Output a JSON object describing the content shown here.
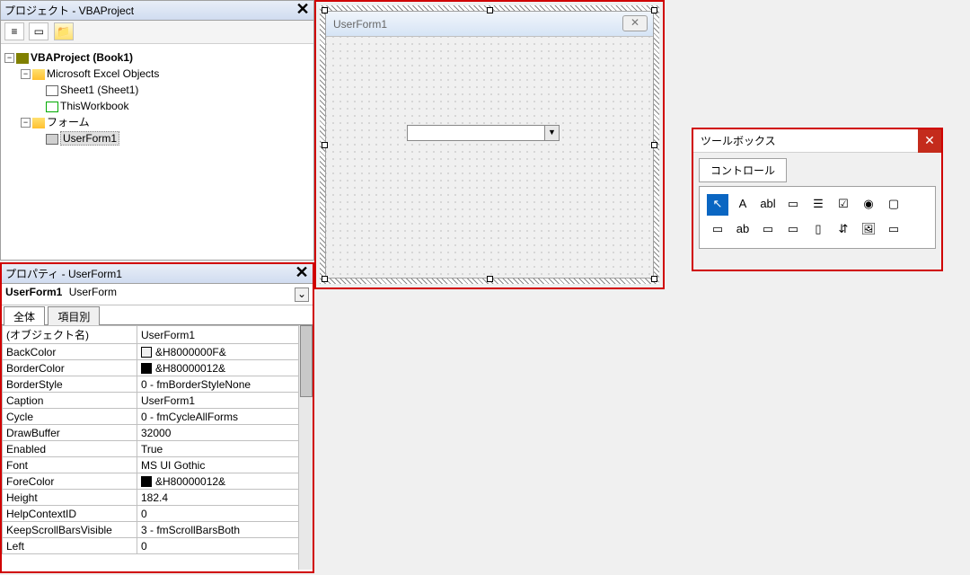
{
  "project": {
    "title": "プロジェクト - VBAProject",
    "root": "VBAProject (Book1)",
    "folder1": "Microsoft Excel Objects",
    "sheet1": "Sheet1 (Sheet1)",
    "thiswb": "ThisWorkbook",
    "folder2": "フォーム",
    "userform": "UserForm1"
  },
  "properties": {
    "title": "プロパティ - UserForm1",
    "obj_name": "UserForm1",
    "obj_type": "UserForm",
    "tab1": "全体",
    "tab2": "項目別",
    "rows": [
      {
        "k": "(オブジェクト名)",
        "v": "UserForm1"
      },
      {
        "k": "BackColor",
        "v": "&H8000000F&",
        "sw": "#f0f0f0"
      },
      {
        "k": "BorderColor",
        "v": "&H80000012&",
        "sw": "#000000"
      },
      {
        "k": "BorderStyle",
        "v": "0 - fmBorderStyleNone"
      },
      {
        "k": "Caption",
        "v": "UserForm1"
      },
      {
        "k": "Cycle",
        "v": "0 - fmCycleAllForms"
      },
      {
        "k": "DrawBuffer",
        "v": "32000"
      },
      {
        "k": "Enabled",
        "v": "True"
      },
      {
        "k": "Font",
        "v": "MS UI Gothic"
      },
      {
        "k": "ForeColor",
        "v": "&H80000012&",
        "sw": "#000000"
      },
      {
        "k": "Height",
        "v": "182.4"
      },
      {
        "k": "HelpContextID",
        "v": "0"
      },
      {
        "k": "KeepScrollBarsVisible",
        "v": "3 - fmScrollBarsBoth"
      },
      {
        "k": "Left",
        "v": "0"
      }
    ]
  },
  "designer": {
    "form_caption": "UserForm1"
  },
  "toolbox": {
    "title": "ツールボックス",
    "tab": "コントロール",
    "tools": [
      {
        "name": "pointer",
        "label": "↖",
        "sel": true
      },
      {
        "name": "label",
        "label": "A"
      },
      {
        "name": "textbox",
        "label": "abl"
      },
      {
        "name": "combobox",
        "label": "▭"
      },
      {
        "name": "listbox",
        "label": "☰"
      },
      {
        "name": "checkbox",
        "label": "☑"
      },
      {
        "name": "optionbutton",
        "label": "◉"
      },
      {
        "name": "togglebutton",
        "label": "▢"
      },
      {
        "name": "frame",
        "label": "▭"
      },
      {
        "name": "commandbutton",
        "label": "ab"
      },
      {
        "name": "tabstrip",
        "label": "▭"
      },
      {
        "name": "multipage",
        "label": "▭"
      },
      {
        "name": "scrollbar",
        "label": "▯"
      },
      {
        "name": "spinbutton",
        "label": "⇵"
      },
      {
        "name": "image",
        "label": "🖼"
      },
      {
        "name": "refedit",
        "label": "▭"
      }
    ]
  }
}
